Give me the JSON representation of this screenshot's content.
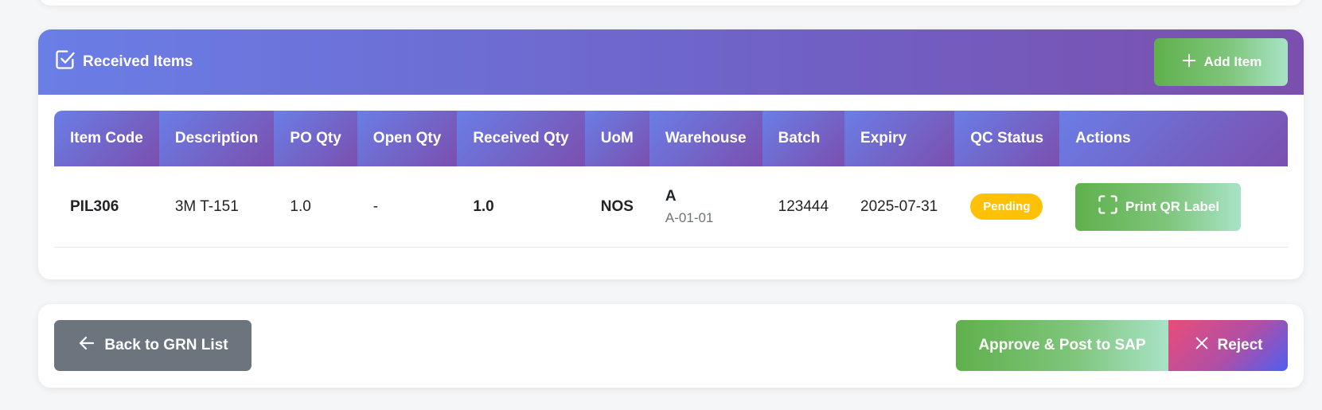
{
  "received_items": {
    "title": "Received Items",
    "add_item_label": "Add Item",
    "columns": [
      "Item Code",
      "Description",
      "PO Qty",
      "Open Qty",
      "Received Qty",
      "UoM",
      "Warehouse",
      "Batch",
      "Expiry",
      "QC Status",
      "Actions"
    ],
    "rows": [
      {
        "item_code": "PIL306",
        "description": "3M T-151",
        "po_qty": "1.0",
        "open_qty": "-",
        "received_qty": "1.0",
        "uom": "NOS",
        "warehouse": "A",
        "warehouse_location": "A-01-01",
        "batch": "123444",
        "expiry": "2025-07-31",
        "qc_status": "Pending",
        "action_label": "Print QR Label"
      }
    ]
  },
  "footer": {
    "back_label": "Back to GRN List",
    "approve_label": "Approve & Post to SAP",
    "reject_label": "Reject"
  },
  "colors": {
    "header_gradient_start": "#6a7ee6",
    "header_gradient_end": "#7b4fae",
    "success_green": "#5fb04c",
    "pending_yellow": "#ffc107",
    "secondary_gray": "#6c757d"
  },
  "icons": {
    "title_icon": "check-square-icon",
    "add_icon": "plus-icon",
    "qr_icon": "scan-icon",
    "back_icon": "arrow-left-icon",
    "reject_icon": "x-icon"
  }
}
